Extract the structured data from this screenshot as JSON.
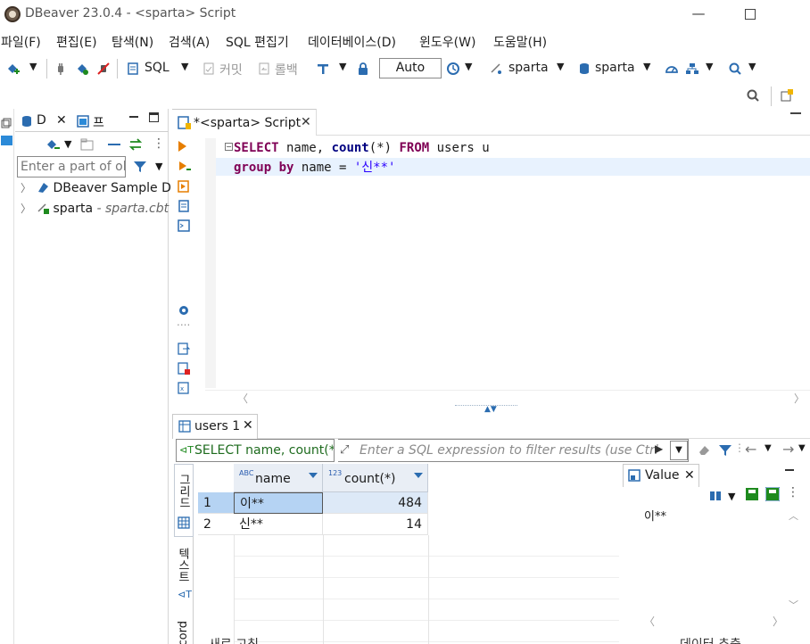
{
  "window": {
    "title": "DBeaver 23.0.4 - <sparta> Script",
    "minimize": "—"
  },
  "menu": {
    "items": [
      "파일(F)",
      "편집(E)",
      "탐색(N)",
      "검색(A)",
      "SQL 편집기",
      "데이터베이스(D)",
      "윈도우(W)",
      "도움말(H)"
    ]
  },
  "toolbar": {
    "sql_label": "SQL",
    "commit_label": "커밋",
    "rollback_label": "롤백",
    "transaction_mode": "Auto",
    "datasource": "sparta",
    "schema": "sparta"
  },
  "navigator": {
    "tab_label": "D",
    "tab2_label": "프",
    "filter_placeholder": "Enter a part of ol",
    "items": [
      {
        "label": "DBeaver Sample D",
        "sub": ""
      },
      {
        "label": "sparta",
        "sub": " - sparta.cbt"
      }
    ]
  },
  "editor": {
    "tab_label": "*<sparta> Script",
    "lines": [
      {
        "parts": [
          {
            "t": "SELECT",
            "c": "kw"
          },
          {
            "t": " name, ",
            "c": ""
          },
          {
            "t": "count",
            "c": "fn"
          },
          {
            "t": "(*) ",
            "c": ""
          },
          {
            "t": "FROM",
            "c": "kw"
          },
          {
            "t": " users u",
            "c": ""
          }
        ]
      },
      {
        "parts": [
          {
            "t": "group by",
            "c": "kw"
          },
          {
            "t": " name = ",
            "c": ""
          },
          {
            "t": "'신**'",
            "c": "str"
          }
        ]
      }
    ]
  },
  "results": {
    "tab_label": "users 1",
    "filter_sql": "SELECT name, count(*)",
    "filter_placeholder": "Enter a SQL expression to filter results (use Ctrl",
    "vertical_tabs": [
      "그리드",
      "텍스트",
      "Record"
    ],
    "columns": [
      {
        "type": "ABC",
        "name": "name"
      },
      {
        "type": "123",
        "name": "count(*)"
      }
    ],
    "rows": [
      {
        "num": "1",
        "name": "이**",
        "count": "484"
      },
      {
        "num": "2",
        "name": "신**",
        "count": "14"
      }
    ]
  },
  "value_panel": {
    "tab_label": "Value",
    "value": "이**"
  },
  "bottom": {
    "label": "데이터 추출",
    "refresh_label": "새로 고침"
  },
  "colors": {
    "keyword": "#7f0055",
    "function": "#000080",
    "string": "#2a00ff",
    "selection": "#b5d3f3",
    "header": "#e9eef5",
    "accent": "#2b6cb0"
  }
}
